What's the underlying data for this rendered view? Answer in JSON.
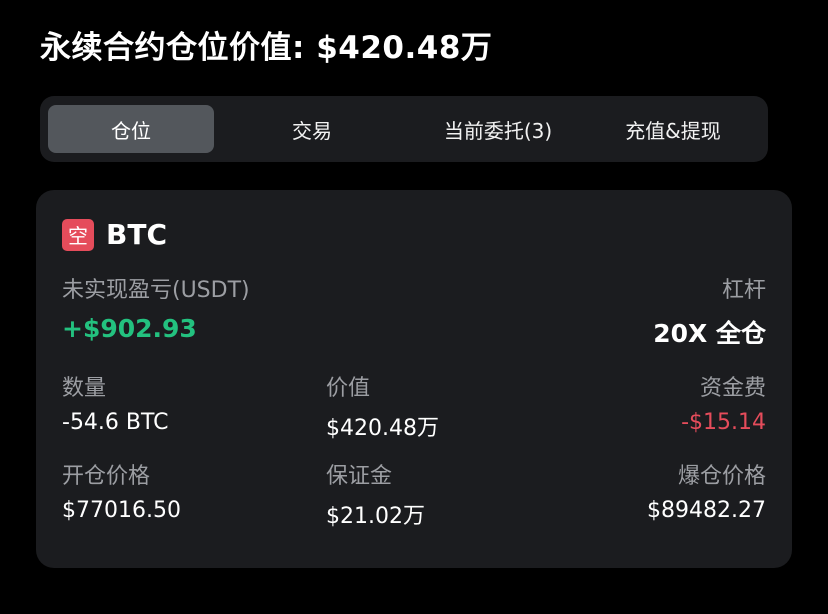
{
  "header": {
    "title": "永续合约仓位价值: $420.48万"
  },
  "tabs": [
    {
      "label": "仓位",
      "active": true
    },
    {
      "label": "交易",
      "active": false
    },
    {
      "label": "当前委托(3)",
      "active": false
    },
    {
      "label": "充值&提现",
      "active": false
    }
  ],
  "position": {
    "side_badge": "空",
    "symbol": "BTC",
    "unrealized_pnl_label": "未实现盈亏(USDT)",
    "unrealized_pnl_value": "+$902.93",
    "leverage_label": "杠杆",
    "leverage_value": "20X 全仓",
    "quantity_label": "数量",
    "quantity_value": "-54.6 BTC",
    "value_label": "价值",
    "value_value": "$420.48万",
    "funding_label": "资金费",
    "funding_value": "-$15.14",
    "entry_price_label": "开仓价格",
    "entry_price_value": "$77016.50",
    "margin_label": "保证金",
    "margin_value": "$21.02万",
    "liq_price_label": "爆仓价格",
    "liq_price_value": "$89482.27"
  },
  "colors": {
    "background": "#000000",
    "card": "#1b1c1f",
    "active_tab": "#53575c",
    "profit_green": "#23c17f",
    "loss_red": "#e54c5b",
    "muted_text": "#9c9ea3"
  }
}
